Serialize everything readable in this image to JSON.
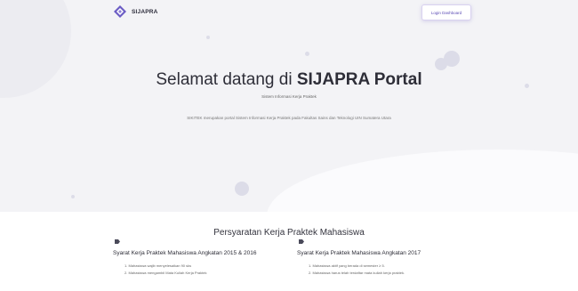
{
  "header": {
    "brand_name": "SIJAPRA",
    "logo_icon": "diamond-logo-icon",
    "login_label": "Login Dashboard"
  },
  "hero": {
    "title_prefix": "Selamat datang di ",
    "title_bold": "SIJAPRA Portal",
    "subtitle": "Sistem Informasi Kerja Praktek",
    "description": "SIKITEK merupakan portal Sistem Informasi Kerja Praktek pada Fakultas Sains dan Teknologi UIN Sumatera Utara"
  },
  "requirements": {
    "title": "Persyaratan Kerja Praktek Mahasiswa",
    "columns": [
      {
        "icon": "tag-icon",
        "title": "Syarat Kerja Praktek Mahasiswa Angkatan 2015 & 2016",
        "items": [
          "1. Mahasiswa wajib menyelesaikan 90 sks",
          "2. Mahasiswa mengambil Mata Kuliah Kerja Praktek"
        ]
      },
      {
        "icon": "tag-icon",
        "title": "Syarat Kerja Praktek Mahasiswa Angkatan 2017",
        "items": [
          "1. Mahasiswa aktif yang berada di semester ≥ 5.",
          "2. Mahasiswa harus telah terdaftar mata kuliah kerja praktek."
        ]
      }
    ]
  },
  "colors": {
    "accent": "#5b4bb5",
    "hero_bg": "#f3f3f6",
    "bubble": "#dcdce8"
  }
}
